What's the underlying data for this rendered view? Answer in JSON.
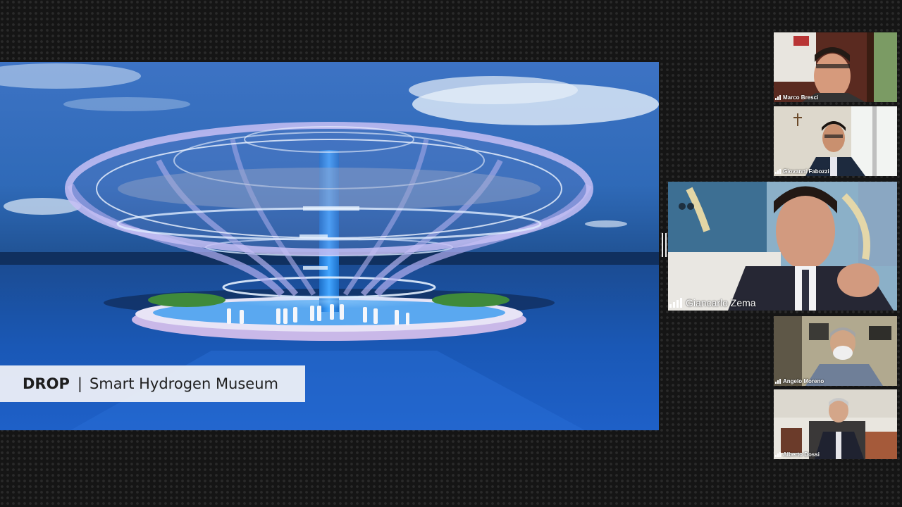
{
  "shared_screen": {
    "caption_strong": "DROP",
    "caption_separator": "|",
    "caption_rest": "Smart Hydrogen Museum"
  },
  "participants": [
    {
      "name": "Marco Bresci"
    },
    {
      "name": "Giovanni Fabozzi"
    },
    {
      "name": "Giancarlo Zema"
    },
    {
      "name": "Angelo Moreno"
    },
    {
      "name": "Alberto Dossi"
    }
  ],
  "colors": {
    "sky": "#2b63b5",
    "sea": "#1a55b8",
    "caption_bg": "#eef0f6",
    "panel_bg": "#151515"
  }
}
